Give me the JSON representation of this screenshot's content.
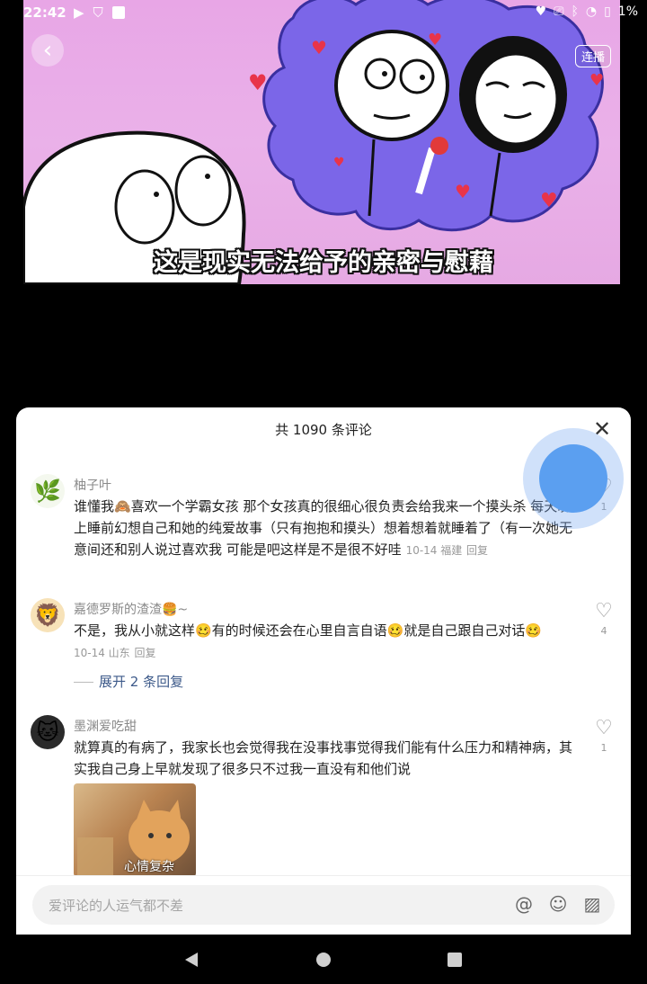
{
  "status_bar": {
    "time": "22:42",
    "left_icons": [
      "play-icon",
      "shield-icon",
      "square-icon"
    ],
    "right_icons": [
      "heart-icon",
      "cast-icon",
      "bluetooth-icon",
      "wifi-icon",
      "battery-icon"
    ],
    "battery": "1%"
  },
  "video": {
    "subtitle": "这是现实无法给予的亲密与慰藉",
    "autoplay_label": "连播",
    "back_icon": "chevron-left-icon"
  },
  "comments_panel": {
    "title": "共 1090 条评论",
    "close_icon": "close-icon",
    "comments": [
      {
        "user": "柚子叶",
        "avatar": "🌿",
        "text": "谁懂我🙈喜欢一个学霸女孩 那个女孩真的很细心很负责会给我来一个摸头杀 每天晚上睡前幻想自己和她的纯爱故事（只有抱抱和摸头）想着想着就睡着了（有一次她无意间还和别人说过喜欢我 可能是吧这样是不是很不好哇",
        "meta": "10-14 福建",
        "reply": "回复",
        "likes": "1"
      },
      {
        "user": "嘉德罗斯的渣渣🍔~",
        "avatar": "🦁",
        "text": "不是，我从小就这样🥴有的时候还会在心里自言自语🥴就是自己跟自己对话🥴",
        "meta": "10-14 山东",
        "reply": "回复",
        "likes": "4",
        "expand_label": "展开 2 条回复"
      },
      {
        "user": "墨渊爱吃甜",
        "avatar": "🐱",
        "text": "就算真的有病了，我家长也会觉得我在没事找事觉得我们能有什么压力和精神病，其实我自己身上早就发现了很多只不过我一直没有和他们说",
        "likes": "1",
        "image_caption": "心情复杂"
      }
    ],
    "input_placeholder": "爱评论的人运气都不差",
    "input_icons": [
      "at-icon",
      "emoji-icon",
      "image-icon"
    ]
  },
  "nav_bar": {
    "buttons": [
      "back-triangle-icon",
      "home-circle-icon",
      "recents-square-icon"
    ]
  }
}
